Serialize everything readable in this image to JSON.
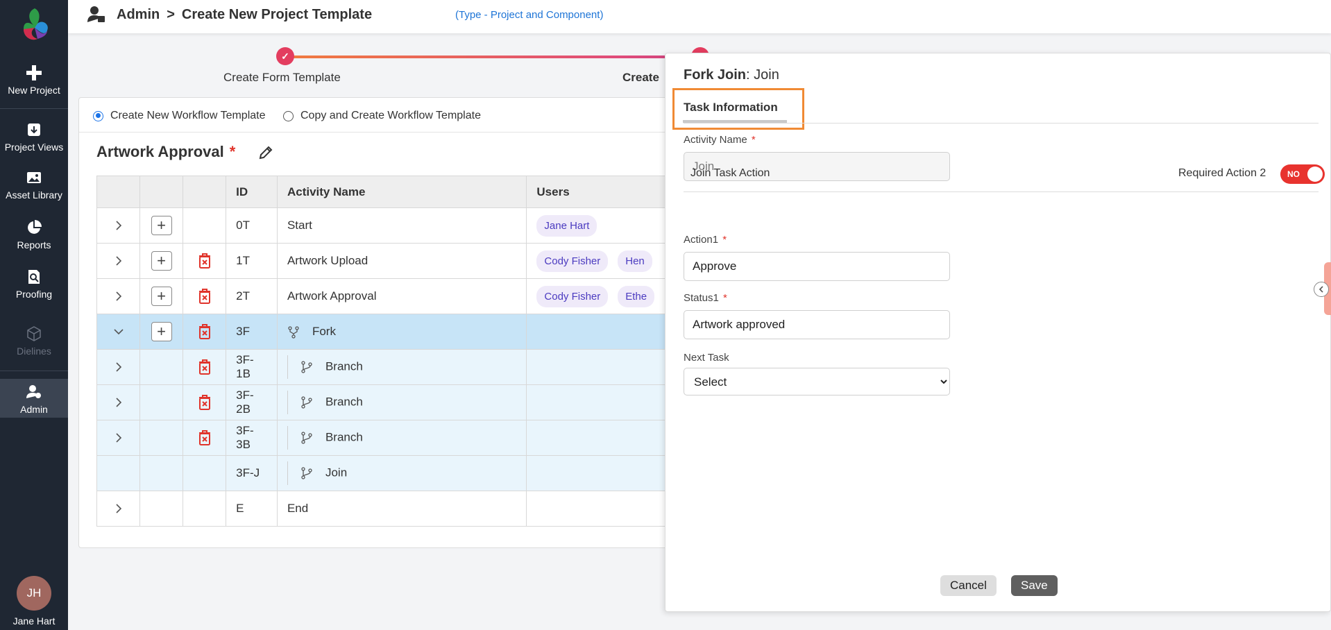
{
  "sidebar": {
    "items": [
      {
        "label": "New Project"
      },
      {
        "label": "Project Views"
      },
      {
        "label": "Asset Library"
      },
      {
        "label": "Reports"
      },
      {
        "label": "Proofing"
      },
      {
        "label": "Dielines"
      },
      {
        "label": "Admin"
      }
    ],
    "user_initials": "JH",
    "user_name": "Jane Hart"
  },
  "header": {
    "crumb_root": "Admin",
    "crumb_sep": ">",
    "crumb_page": "Create New Project Template",
    "type_note": "(Type - Project and Component)"
  },
  "stepper": {
    "step1_label": "Create Form Template",
    "step2_label": "Create"
  },
  "workflow": {
    "radio_new": "Create New Workflow Template",
    "radio_copy": "Copy and Create Workflow Template",
    "title": "Artwork Approval",
    "required_mark": "*",
    "columns": [
      "",
      "",
      "",
      "ID",
      "Activity Name",
      "Users"
    ],
    "rows": [
      {
        "id": "0T",
        "name": "Start",
        "users": [
          "Jane Hart"
        ]
      },
      {
        "id": "1T",
        "name": "Artwork Upload",
        "users": [
          "Cody Fisher",
          "Hen"
        ]
      },
      {
        "id": "2T",
        "name": "Artwork Approval",
        "users": [
          "Cody Fisher",
          "Ethe"
        ]
      },
      {
        "id": "3F",
        "name": "Fork",
        "users": []
      },
      {
        "id": "3F-1B",
        "name": "Branch",
        "users": []
      },
      {
        "id": "3F-2B",
        "name": "Branch",
        "users": []
      },
      {
        "id": "3F-3B",
        "name": "Branch",
        "users": []
      },
      {
        "id": "3F-J",
        "name": "Join",
        "users": []
      },
      {
        "id": "E",
        "name": "End",
        "users": []
      }
    ]
  },
  "panel": {
    "title_bold": "Fork Join",
    "title_rest": ": Join",
    "tab_label": "Task Information",
    "activity_name_label": "Activity Name",
    "activity_name_value": "Join",
    "join_task_action": "Join Task Action",
    "required_action": "Required Action 2",
    "toggle_text": "NO",
    "action1_label": "Action1",
    "action1_value": "Approve",
    "status1_label": "Status1",
    "status1_value": "Artwork approved",
    "next_task_label": "Next Task",
    "next_task_value": "Select",
    "cancel_label": "Cancel",
    "save_label": "Save",
    "required_mark": "*"
  },
  "colors": {
    "sidebar_bg": "#1f2733",
    "accent_blue": "#1a73e8",
    "highlight_orange": "#f08a34",
    "toggle_red": "#e8332e",
    "selected_row": "#c7e4f7",
    "sub_row": "#e9f5fc",
    "delete_red": "#e0342b"
  }
}
